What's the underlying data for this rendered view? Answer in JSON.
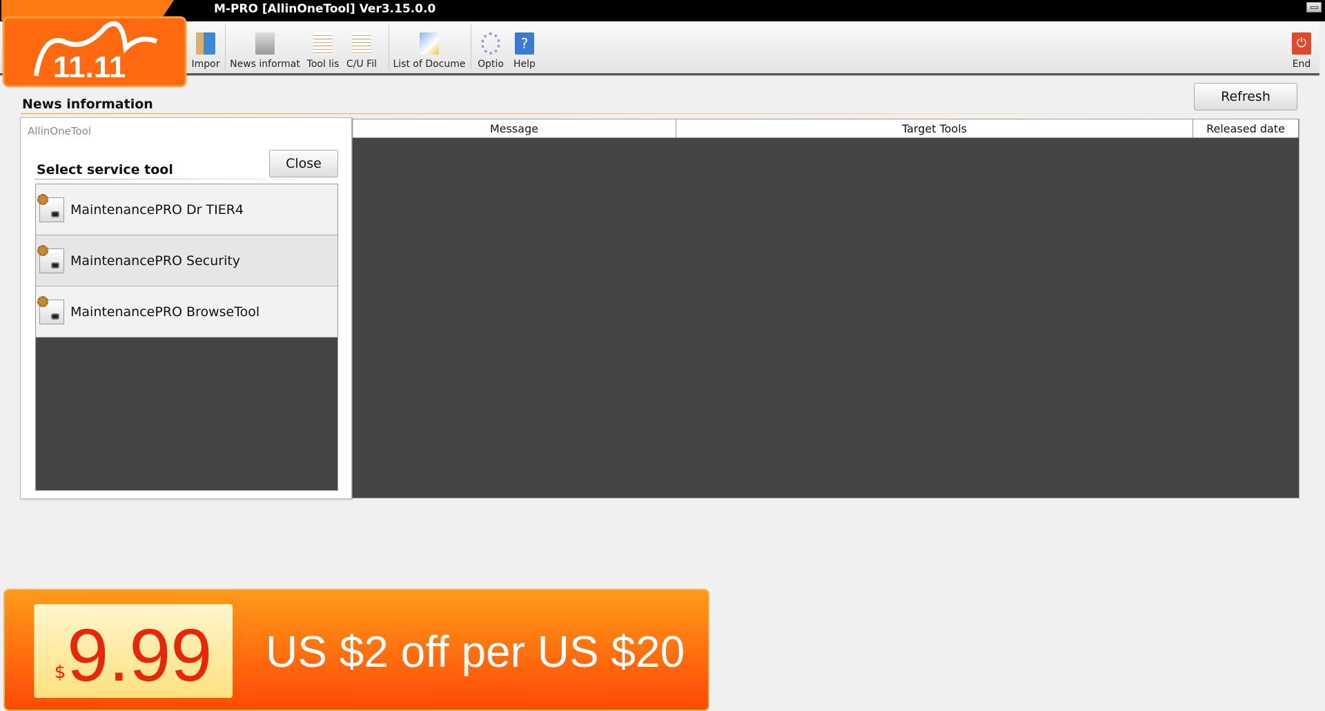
{
  "window": {
    "title": "M-PRO [AllinOneTool] Ver3.15.0.0"
  },
  "toolbar": {
    "items": [
      {
        "label": "Impor",
        "icon": "import-icon"
      },
      {
        "label": "News informat",
        "icon": "news-icon"
      },
      {
        "label": "Tool lis",
        "icon": "tool-list-icon"
      },
      {
        "label": "C/U Fil",
        "icon": "cu-file-icon"
      },
      {
        "label": "List of Docume",
        "icon": "documents-icon"
      },
      {
        "label": "Optio",
        "icon": "gear-icon"
      },
      {
        "label": "Help",
        "icon": "help-icon"
      }
    ],
    "end_label": "End"
  },
  "main": {
    "heading": "News information",
    "refresh_label": "Refresh",
    "columns": [
      "Message",
      "Target Tools",
      "Released date"
    ]
  },
  "popup": {
    "app_name": "AllinOneTool",
    "heading": "Select service tool",
    "close_label": "Close",
    "tools": [
      "MaintenancePRO Dr TIER4",
      "MaintenancePRO Security",
      "MaintenancePRO BrowseTool"
    ]
  },
  "promo": {
    "badge_text": "11.11",
    "currency": "$",
    "price": "9.99",
    "text": "US $2 off per US $20"
  },
  "colors": {
    "accent": "#ff6a00",
    "end": "#e0492a",
    "table_bg": "#454545"
  }
}
